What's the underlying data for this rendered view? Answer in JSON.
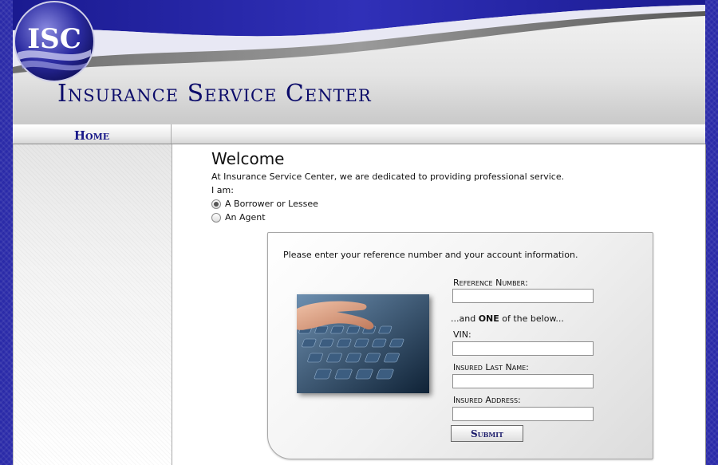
{
  "header": {
    "site_title": "Insurance Service Center",
    "logo_text": "ISC"
  },
  "nav": {
    "home": "Home"
  },
  "main": {
    "welcome": "Welcome",
    "intro": "At Insurance Service Center, we are dedicated to providing professional service.",
    "i_am": "I am:",
    "roles": [
      {
        "label": "A Borrower or Lessee",
        "checked": true
      },
      {
        "label": "An Agent",
        "checked": false
      }
    ]
  },
  "login": {
    "instructions": "Please enter your reference number and your account information.",
    "reference_label": "Reference Number:",
    "and_one_prefix": "...and ",
    "and_one_bold": "ONE",
    "and_one_suffix": " of the below...",
    "vin_label": "VIN:",
    "last_name_label": "Insured Last Name:",
    "address_label": "Insured Address:",
    "submit_label": "Submit",
    "reference_value": "",
    "vin_value": "",
    "last_name_value": "",
    "address_value": ""
  },
  "colors": {
    "brand_blue": "#0b0b6a",
    "background_blue": "#2a2aa8"
  }
}
